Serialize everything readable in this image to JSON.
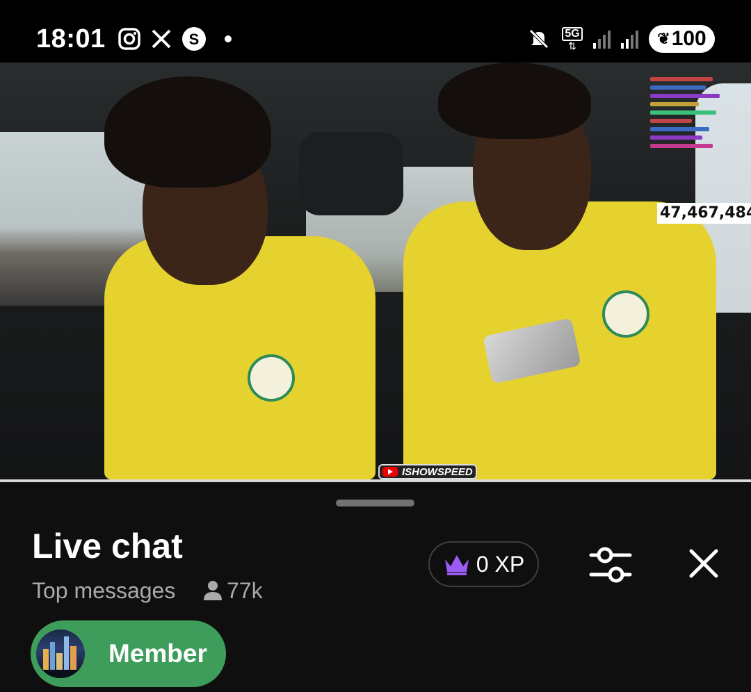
{
  "status_bar": {
    "time": "18:01",
    "notification_icons": [
      "instagram-icon",
      "x-icon",
      "threads-icon",
      "dot-icon"
    ],
    "system_icons": [
      "mute-icon",
      "5g-icon",
      "signal-icon",
      "signal-icon-2"
    ],
    "network_label": "5G",
    "battery": "100"
  },
  "video": {
    "viewer_count_overlay": "47,467,484",
    "channel_watermark": "ISHOWSPEED"
  },
  "chat_panel": {
    "title": "Live chat",
    "mode_label": "Top messages",
    "viewer_count": "77k",
    "xp_label": "0 XP",
    "member_button_label": "Member"
  },
  "colors": {
    "panel_bg": "#0f0f0f",
    "member_green": "#3e9d5b",
    "crown_purple": "#9b5cf6",
    "subtext": "#aaaaaa"
  }
}
